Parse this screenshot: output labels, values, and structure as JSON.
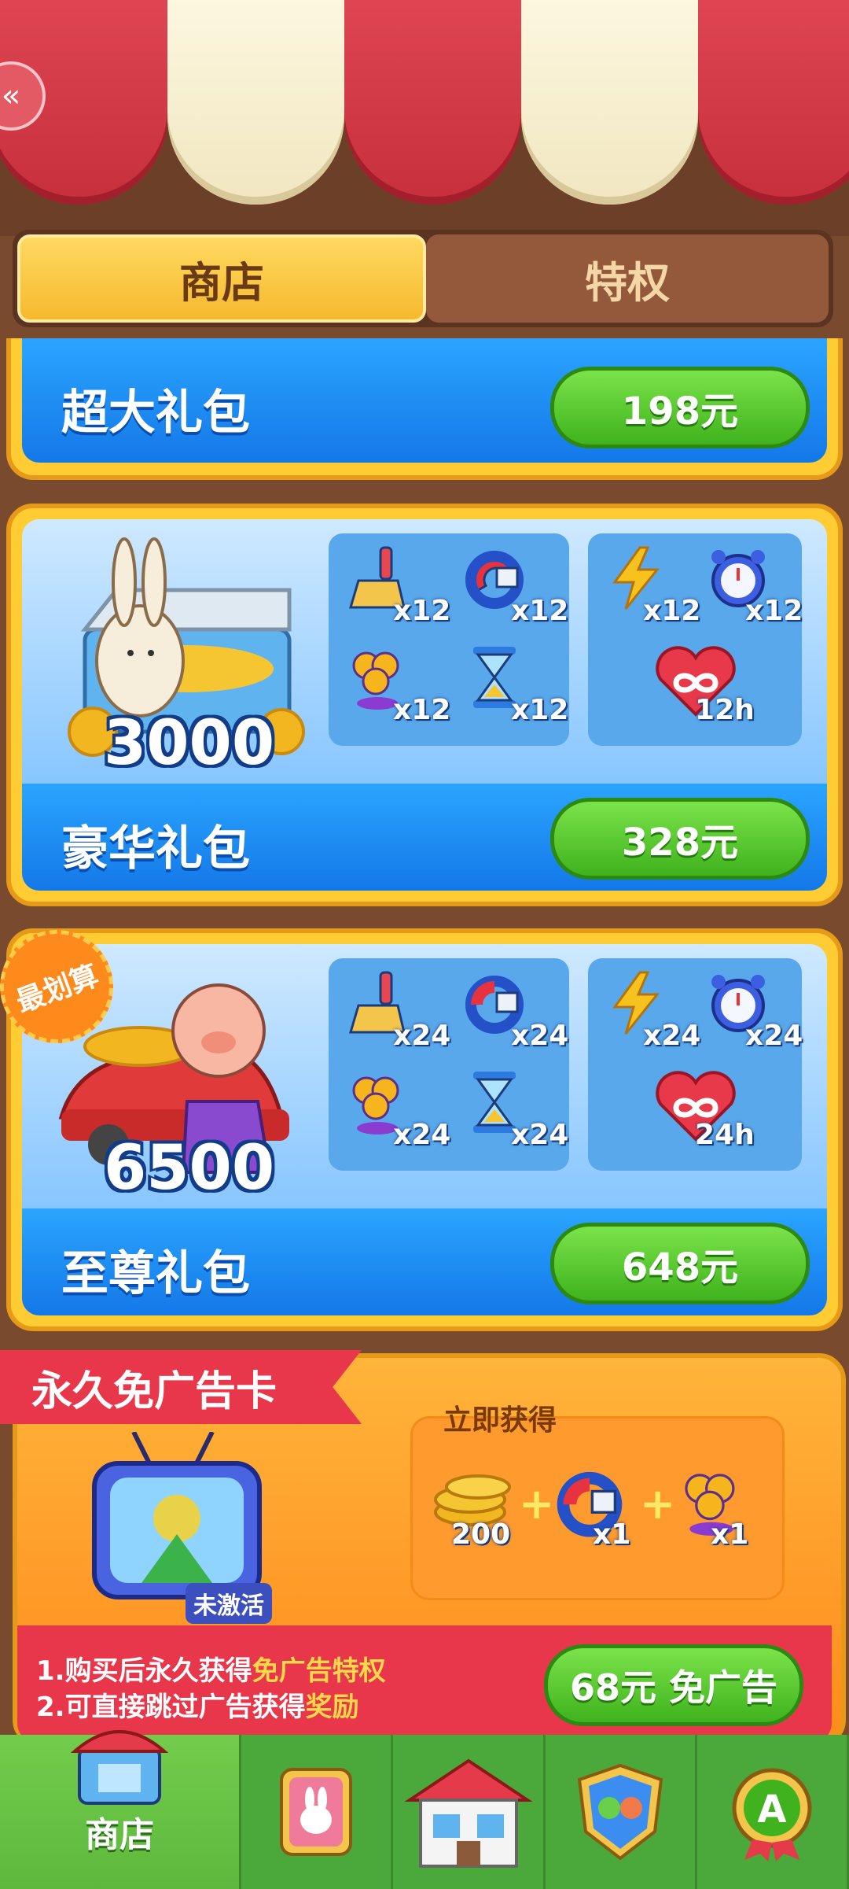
{
  "back_button": {
    "icon": "back-arrow-icon"
  },
  "tabs": [
    {
      "label": "商店",
      "active": true
    },
    {
      "label": "特权",
      "active": false
    }
  ],
  "packs": [
    {
      "name": "超大礼包",
      "price": "198元"
    },
    {
      "name": "豪华礼包",
      "price": "328元",
      "coins": "3000",
      "items": [
        {
          "icon": "broom-icon",
          "qty": "x12"
        },
        {
          "icon": "magnet-icon",
          "qty": "x12"
        },
        {
          "icon": "lightning-icon",
          "qty": "x12"
        },
        {
          "icon": "alarm-clock-icon",
          "qty": "x12"
        },
        {
          "icon": "fan-icon",
          "qty": "x12"
        },
        {
          "icon": "hourglass-icon",
          "qty": "x12"
        },
        {
          "icon": "infinite-heart-icon",
          "qty": "12h"
        }
      ]
    },
    {
      "name": "至尊礼包",
      "price": "648元",
      "coins": "6500",
      "badge": "最划算",
      "items": [
        {
          "icon": "broom-icon",
          "qty": "x24"
        },
        {
          "icon": "magnet-icon",
          "qty": "x24"
        },
        {
          "icon": "lightning-icon",
          "qty": "x24"
        },
        {
          "icon": "alarm-clock-icon",
          "qty": "x24"
        },
        {
          "icon": "fan-icon",
          "qty": "x24"
        },
        {
          "icon": "hourglass-icon",
          "qty": "x24"
        },
        {
          "icon": "infinite-heart-icon",
          "qty": "24h"
        }
      ]
    }
  ],
  "ad_card": {
    "title": "永久免广告卡",
    "status": "未激活",
    "instant_label": "立即获得",
    "rewards": [
      {
        "icon": "coins-icon",
        "qty": "200"
      },
      {
        "icon": "magnet-icon",
        "qty": "x1"
      },
      {
        "icon": "fan-icon",
        "qty": "x1"
      }
    ],
    "desc1_a": "1.购买后永久获得",
    "desc1_b": "免广告特权",
    "desc2_a": "2.可直接跳过广告获得",
    "desc2_b": "奖励",
    "button": "68元 免广告"
  },
  "nav": [
    {
      "label": "商店",
      "icon": "shop-icon",
      "active": true
    },
    {
      "label": "",
      "icon": "rabbit-card-icon",
      "active": false
    },
    {
      "label": "",
      "icon": "house-icon",
      "active": false
    },
    {
      "label": "",
      "icon": "team-shield-icon",
      "active": false
    },
    {
      "label": "",
      "icon": "a-badge-icon",
      "active": false
    }
  ],
  "colors": {
    "price_green": "#3fb21d",
    "panel_yellow": "#ffcc33",
    "blue": "#1478e8",
    "ribbon_red": "#e8374b"
  }
}
